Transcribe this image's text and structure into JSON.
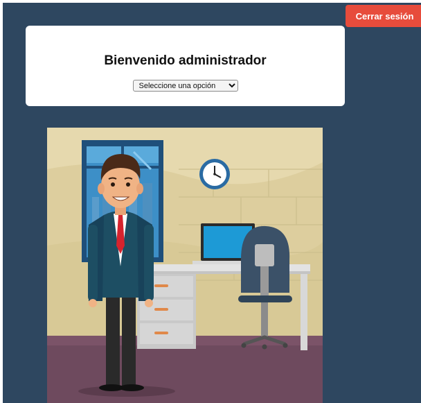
{
  "header": {
    "logout_label": "Cerrar sesión"
  },
  "welcome": {
    "title": "Bienvenido administrador",
    "select": {
      "selected": "Seleccione una opción",
      "options": [
        "Seleccione una opción"
      ]
    }
  },
  "illustration": {
    "icon": "office-administrator-illustration"
  },
  "colors": {
    "background": "#2e4760",
    "logout_button": "#e74c3c",
    "card": "#ffffff"
  }
}
